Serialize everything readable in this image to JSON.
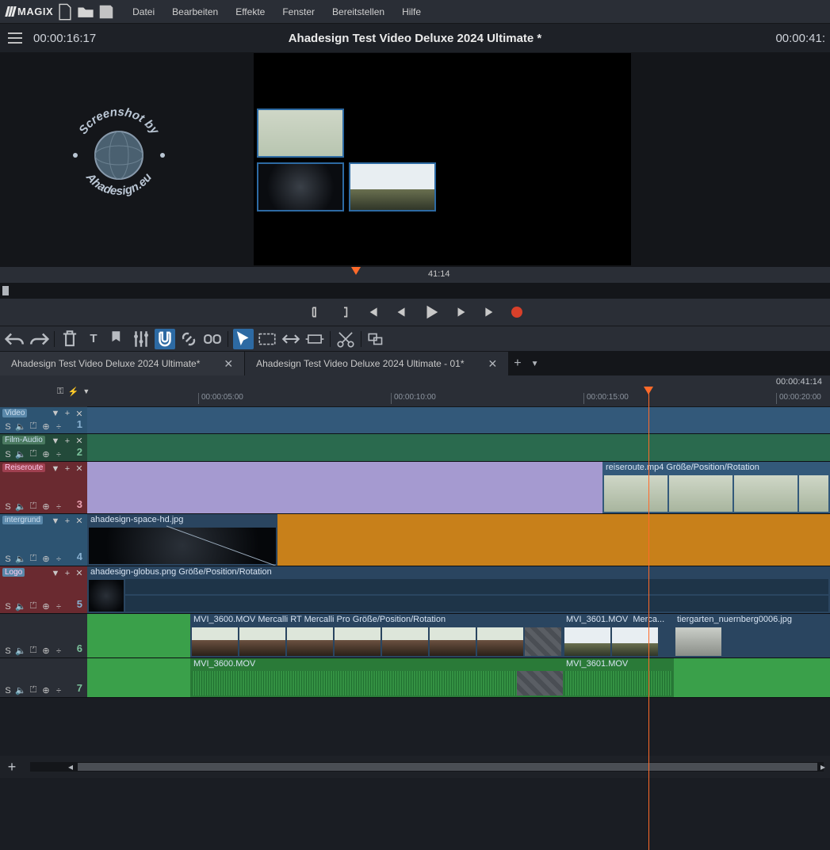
{
  "app": {
    "brand": "MAGIX"
  },
  "menu": {
    "file": "Datei",
    "edit": "Bearbeiten",
    "effects": "Effekte",
    "window": "Fenster",
    "share": "Bereitstellen",
    "help": "Hilfe"
  },
  "header": {
    "timecode_left": "00:00:16:17",
    "title": "Ahadesign Test Video Deluxe 2024 Ultimate *",
    "timecode_right": "00:00:41:"
  },
  "watermark": {
    "text_top": "Screenshot by",
    "text_bottom": "Ahadesign.eu"
  },
  "scrub": {
    "duration_label": "41:14"
  },
  "tabs": [
    {
      "label": "Ahadesign Test Video Deluxe 2024 Ultimate*",
      "active": true
    },
    {
      "label": "Ahadesign Test Video Deluxe 2024 Ultimate - 01*",
      "active": false
    }
  ],
  "ruler": {
    "total": "00:00:41:14",
    "marks": [
      "00:00:05:00",
      "00:00:10:00",
      "00:00:15:00",
      "00:00:20:00"
    ]
  },
  "tracks": [
    {
      "num": "1",
      "name": "Video",
      "head": "th-blue",
      "lane": "ln-blue",
      "txt": "#88b0d0"
    },
    {
      "num": "2",
      "name": "Film-Audio",
      "head": "th-teal",
      "lane": "ln-green",
      "txt": "#7ac09a"
    },
    {
      "num": "3",
      "name": "Reiseroute",
      "head": "th-red",
      "lane": "",
      "txt": "#e8a0b0"
    },
    {
      "num": "4",
      "name": "intergrund",
      "head": "th-blue",
      "lane": "",
      "txt": "#88b0d0"
    },
    {
      "num": "5",
      "name": "Logo",
      "head": "th-red",
      "lane": "",
      "txt": "#88b0d0"
    },
    {
      "num": "6",
      "name": "",
      "head": "th-grey",
      "lane": "",
      "txt": "#7ac09a"
    },
    {
      "num": "7",
      "name": "",
      "head": "th-grey",
      "lane": "",
      "txt": "#7ac09a"
    }
  ],
  "clips": {
    "t3_label": "reiseroute.mp4   Größe/Position/Rotation",
    "t4_label": "ahadesign-space-hd.jpg",
    "t5_label": "ahadesign-globus.png   Größe/Position/Rotation",
    "t6_a": "MVI_3600.MOV   Mercalli RT   Mercalli Pro   Größe/Position/Rotation",
    "t6_b": "MVI_3601.MOV",
    "t6_b2": "Merca...",
    "t6_c": "tiergarten_nuernberg0006.jpg",
    "t7_a": "MVI_3600.MOV",
    "t7_b": "MVI_3601.MOV"
  },
  "track_controls": {
    "solo": "S"
  }
}
